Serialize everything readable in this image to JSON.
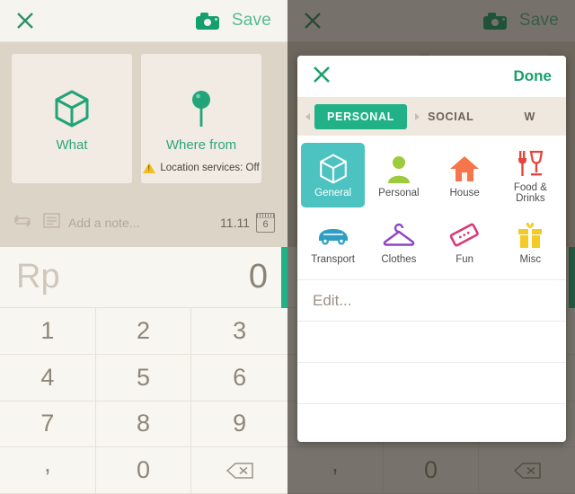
{
  "topbar": {
    "close_icon": "close-x-icon",
    "camera_icon": "camera-icon",
    "save_label": "Save"
  },
  "detail": {
    "what_card": {
      "icon": "box-icon",
      "label": "What"
    },
    "where_card": {
      "icon": "map-pin-icon",
      "label": "Where from",
      "warning_icon": "warning-triangle-icon",
      "warning_text": "Location services: Off"
    },
    "note": {
      "repeat_icon": "repeat-icon",
      "note_icon": "note-lines-icon",
      "placeholder": "Add a note...",
      "time": "11.11",
      "calendar_icon": "calendar-icon",
      "calendar_day": "6"
    }
  },
  "amount": {
    "currency": "Rp",
    "value": "0",
    "accent_color": "#21b187"
  },
  "keypad": {
    "keys": [
      "1",
      "2",
      "3",
      "4",
      "5",
      "6",
      "7",
      "8",
      "9",
      ",",
      "0"
    ],
    "backspace_icon": "backspace-icon"
  },
  "modal": {
    "close_icon": "close-x-icon",
    "done_label": "Done",
    "tabs": [
      {
        "label": "PERSONAL",
        "active": true
      },
      {
        "label": "SOCIAL",
        "active": false
      },
      {
        "label": "W",
        "active": false
      }
    ],
    "categories": [
      {
        "name": "General",
        "icon": "box-icon",
        "color": "#ffffff",
        "selected": true
      },
      {
        "name": "Personal",
        "icon": "person-icon",
        "color": "#9ccb3b",
        "selected": false
      },
      {
        "name": "House",
        "icon": "house-icon",
        "color": "#f4764a",
        "selected": false
      },
      {
        "name": "Food\n& Drinks",
        "icon": "food-drink-icon",
        "color": "#e5463c",
        "selected": false
      },
      {
        "name": "Transport",
        "icon": "car-icon",
        "color": "#2e9fc4",
        "selected": false
      },
      {
        "name": "Clothes",
        "icon": "hanger-icon",
        "color": "#8e44c9",
        "selected": false
      },
      {
        "name": "Fun",
        "icon": "ticket-icon",
        "color": "#d93b7a",
        "selected": false
      },
      {
        "name": "Misc",
        "icon": "gift-icon",
        "color": "#f2cb26",
        "selected": false
      }
    ],
    "edit_label": "Edit...",
    "blank_rows": 3,
    "selected_color": "#4cc3c1"
  }
}
